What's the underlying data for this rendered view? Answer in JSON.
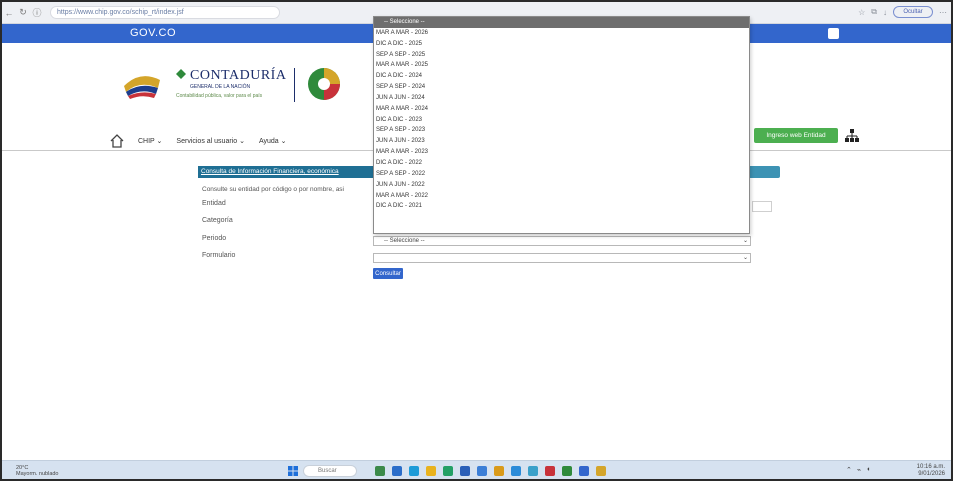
{
  "browser": {
    "url": "https://www.chip.gov.co/schip_rt/index.jsf",
    "profile_label": "Ocultar"
  },
  "gov": {
    "logo_text": "GOV.CO"
  },
  "header": {
    "org_name": "CONTADURÍA",
    "org_sub": "GENERAL DE LA NACIÓN",
    "org_tagline": "Contabilidad pública, valor para el país"
  },
  "nav": {
    "items": [
      "CHIP",
      "Servicios al usuario",
      "Ayuda"
    ],
    "ingreso_label": "Ingreso web Entidad"
  },
  "form": {
    "title": "Consulta de Información Financiera, económica",
    "hint": "Consulte su entidad por código o por nombre, asi",
    "labels": [
      "Entidad",
      "Categoría",
      "Periodo",
      "Formulario"
    ],
    "periodo_value": "-- Seleccione --",
    "formulario_value": "",
    "consultar_label": "Consultar"
  },
  "dropdown": {
    "options": [
      "-- Seleccione --",
      "MAR A MAR - 2026",
      "DIC A DIC - 2025",
      "SEP A SEP - 2025",
      "MAR A MAR - 2025",
      "DIC A DIC - 2024",
      "SEP A SEP - 2024",
      "JUN A JUN - 2024",
      "MAR A MAR - 2024",
      "DIC A DIC - 2023",
      "SEP A SEP - 2023",
      "JUN A JUN - 2023",
      "MAR A MAR - 2023",
      "DIC A DIC - 2022",
      "SEP A SEP - 2022",
      "JUN A JUN - 2022",
      "MAR A MAR - 2022",
      "DIC A DIC - 2021"
    ]
  },
  "taskbar": {
    "weather_temp": "20°C",
    "weather_desc": "Mayorm. nublado",
    "search_label": "Buscar",
    "time": "10:16 a.m.",
    "date": "9/01/2026"
  },
  "colors": {
    "gov_blue": "#3366cc",
    "title_teal": "#1f6f94",
    "ingreso_green": "#4caf50"
  }
}
